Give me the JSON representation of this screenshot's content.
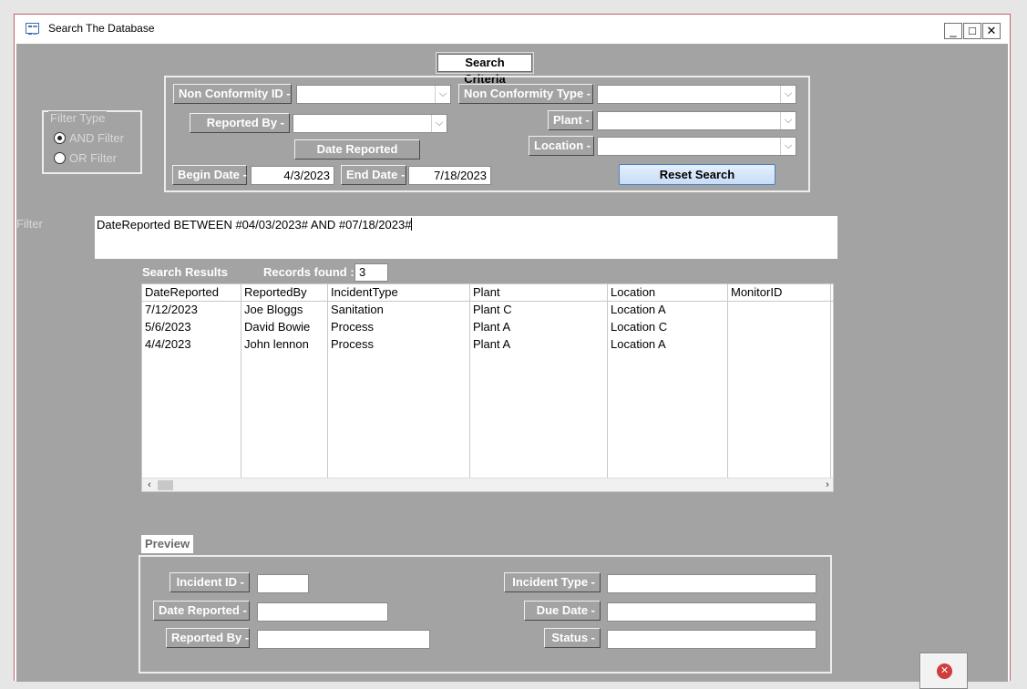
{
  "window": {
    "title": "Search The Database",
    "min_glyph": "_",
    "max_glyph": "□",
    "close_glyph": "✕"
  },
  "criteria": {
    "section_title": "Search Criteria",
    "nc_id_label": "Non Conformity ID -",
    "nc_type_label": "Non Conformity Type -",
    "reported_by_label": "Reported By -",
    "plant_label": "Plant -",
    "location_label": "Location -",
    "date_reported_label": "Date Reported",
    "begin_date_label": "Begin Date -",
    "begin_date_value": "4/3/2023",
    "end_date_label": "End Date -",
    "end_date_value": "7/18/2023",
    "reset_label": "Reset Search",
    "dropdown_glyph": "⌵"
  },
  "filter_type": {
    "legend": "Filter Type",
    "and_label": "AND Filter",
    "or_label": "OR Filter",
    "selected": "AND"
  },
  "filter": {
    "label": "Filter",
    "text": "DateReported BETWEEN #04/03/2023# AND #07/18/2023#"
  },
  "results": {
    "title": "Search Results",
    "records_label": "Records found :",
    "records_count": "3",
    "columns": [
      "DateReported",
      "ReportedBy",
      "IncidentType",
      "Plant",
      "Location",
      "MonitorID"
    ],
    "rows": [
      [
        "7/12/2023",
        "Joe Bloggs",
        "Sanitation",
        "Plant C",
        "Location A",
        ""
      ],
      [
        "5/6/2023",
        "David Bowie",
        "Process",
        "Plant A",
        "Location C",
        ""
      ],
      [
        "4/4/2023",
        "John lennon",
        "Process",
        "Plant A",
        "Location A",
        ""
      ]
    ],
    "scroll_left": "‹",
    "scroll_right": "›"
  },
  "preview": {
    "title": "Preview",
    "incident_id_label": "Incident ID -",
    "date_reported_label": "Date Reported -",
    "reported_by_label": "Reported By -",
    "incident_type_label": "Incident Type -",
    "due_date_label": "Due Date -",
    "status_label": "Status -"
  },
  "close_button": {
    "glyph": "✕"
  }
}
